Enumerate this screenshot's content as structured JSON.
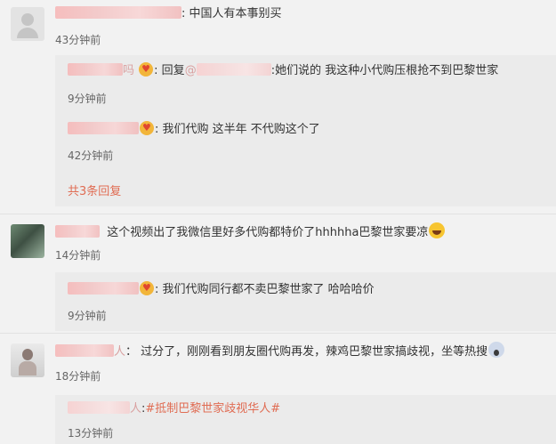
{
  "comments": [
    {
      "text": "中国人有本事别买",
      "time": "43分钟前",
      "replies": [
        {
          "name_suffix": "吗",
          "reply_prefix": "回复",
          "text": ":她们说的 我这种小代购压根抢不到巴黎世家",
          "time": "9分钟前"
        },
        {
          "text": "我们代购 这半年 不代购这个了",
          "time": "42分钟前"
        }
      ],
      "more_replies": "共3条回复"
    },
    {
      "text": "这个视频出了我微信里好多代购都特价了hhhhha巴黎世家要凉",
      "time": "14分钟前",
      "replies": [
        {
          "text": "我们代购同行都不卖巴黎世家了 哈哈哈价",
          "time": "9分钟前"
        }
      ]
    },
    {
      "name_suffix": "人",
      "text": "过分了，刚刚看到朋友圈代购再发，辣鸡巴黎世家搞歧视，坐等热搜",
      "time": "18分钟前",
      "replies": [
        {
          "name_suffix": "人",
          "text": "#抵制巴黎世家歧视华人#",
          "time": "13分钟前"
        }
      ]
    }
  ],
  "icons": {
    "heart_emoji": "heart-eyes-emoji-icon",
    "laugh_emoji": "laughing-emoji-icon",
    "scared_emoji": "scared-emoji-icon"
  },
  "colors": {
    "accent": "#e06c53",
    "background": "#f2f2f2",
    "reply_background": "#ebebeb"
  }
}
